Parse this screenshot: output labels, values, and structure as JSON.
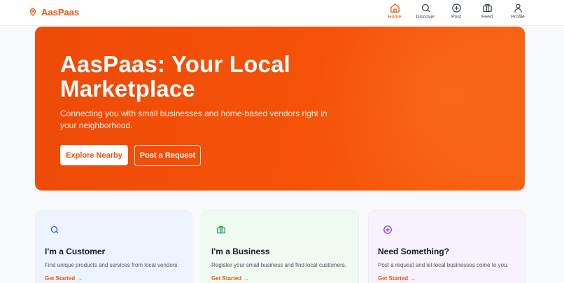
{
  "brand": {
    "name": "AasPaas"
  },
  "nav": {
    "items": [
      {
        "label": "Home",
        "icon": "home-icon",
        "active": true
      },
      {
        "label": "Discover",
        "icon": "search-icon",
        "active": false
      },
      {
        "label": "Post",
        "icon": "plus-circle-icon",
        "active": false
      },
      {
        "label": "Feed",
        "icon": "briefcase-icon",
        "active": false
      },
      {
        "label": "Profile",
        "icon": "user-icon",
        "active": false
      }
    ]
  },
  "hero": {
    "title": "AasPaas: Your Local Marketplace",
    "subtitle": "Connecting you with small businesses and home-based vendors right in your neighborhood.",
    "primary_button": "Explore Nearby",
    "secondary_button": "Post a Request"
  },
  "cards": [
    {
      "title": "I'm a Customer",
      "description": "Find unique products and services from local vendors.",
      "link": "Get Started",
      "icon": "search-icon"
    },
    {
      "title": "I'm a Business",
      "description": "Register your small business and find local customers.",
      "link": "Get Started",
      "icon": "briefcase-icon"
    },
    {
      "title": "Need Something?",
      "description": "Post a request and let local businesses come to you.",
      "link": "Get Started",
      "icon": "plus-circle-icon"
    }
  ],
  "colors": {
    "accent": "#e8540b",
    "hero_gradient_start": "#ee4a08",
    "hero_gradient_end": "#f86312",
    "card_customer_bg": "#eef4ff",
    "card_business_bg": "#effbf1",
    "card_request_bg": "#f8f2fe"
  }
}
